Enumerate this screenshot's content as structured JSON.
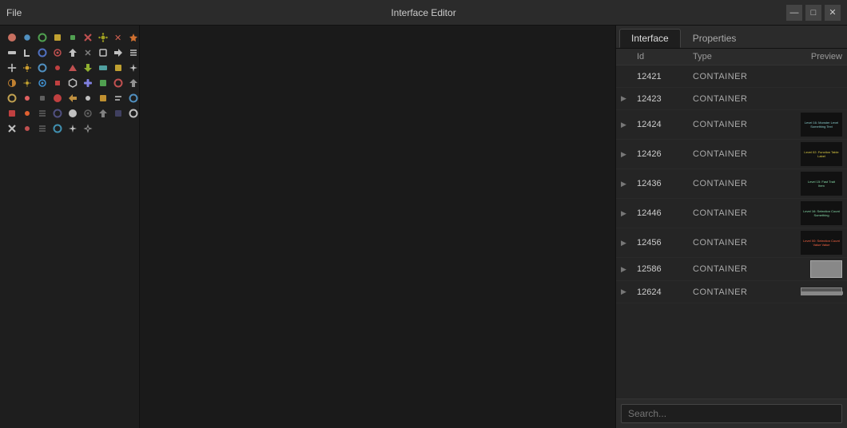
{
  "window": {
    "title": "Interface Editor",
    "menu_label": "File",
    "controls": {
      "minimize": "—",
      "maximize": "□",
      "close": "✕"
    }
  },
  "tabs": [
    {
      "id": "interface",
      "label": "Interface",
      "active": true
    },
    {
      "id": "properties",
      "label": "Properties",
      "active": false
    }
  ],
  "table": {
    "headers": {
      "expand": "",
      "id": "Id",
      "type": "Type",
      "preview": "Preview"
    },
    "rows": [
      {
        "id": "12421",
        "type": "CONTAINER",
        "preview": "none",
        "expanded": false
      },
      {
        "id": "12423",
        "type": "CONTAINER",
        "preview": "none",
        "expanded": false
      },
      {
        "id": "12424",
        "type": "CONTAINER",
        "preview": "text_dark",
        "expanded": false
      },
      {
        "id": "12426",
        "type": "CONTAINER",
        "preview": "text_label",
        "expanded": false
      },
      {
        "id": "12436",
        "type": "CONTAINER",
        "preview": "text_label2",
        "expanded": false
      },
      {
        "id": "12446",
        "type": "CONTAINER",
        "preview": "text_label3",
        "expanded": false
      },
      {
        "id": "12456",
        "type": "CONTAINER",
        "preview": "text_label4",
        "expanded": false
      },
      {
        "id": "12586",
        "type": "CONTAINER",
        "preview": "grey_box",
        "expanded": false
      },
      {
        "id": "12624",
        "type": "CONTAINER",
        "preview": "grey_bar",
        "expanded": false
      }
    ]
  },
  "search": {
    "placeholder": "Search...",
    "value": ""
  },
  "icons": {
    "colors": [
      "#e05050",
      "#50a0e0",
      "#50c050",
      "#d0a030",
      "#c050c0",
      "#50d0d0",
      "#e08050",
      "#8080e0",
      "#aaaaaa",
      "#ff9955",
      "#66ddaa",
      "#dd6688",
      "#88aaff",
      "#ffcc44",
      "#44ccff",
      "#cc88ff",
      "#ff6644"
    ]
  }
}
